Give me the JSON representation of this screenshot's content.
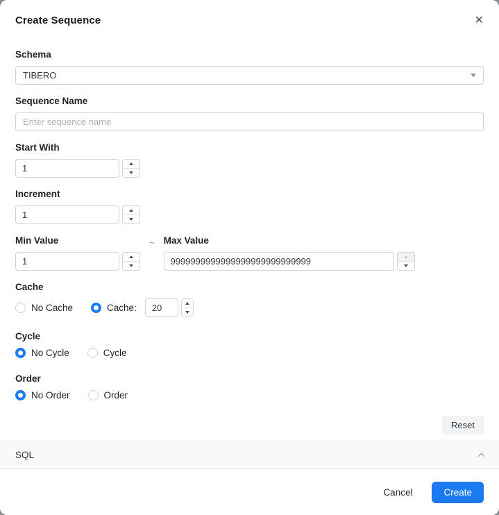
{
  "dialog": {
    "title": "Create Sequence"
  },
  "fields": {
    "schema": {
      "label": "Schema",
      "value": "TIBERO"
    },
    "sequence_name": {
      "label": "Sequence Name",
      "placeholder": "Enter sequence name"
    },
    "start_with": {
      "label": "Start With",
      "value": "1"
    },
    "increment": {
      "label": "Increment",
      "value": "1"
    },
    "min_value": {
      "label": "Min Value",
      "value": "1"
    },
    "range_separator": "~",
    "max_value": {
      "label": "Max Value",
      "value": "9999999999999999999999999999"
    },
    "cache": {
      "label": "Cache",
      "options": [
        {
          "label": "No Cache",
          "selected": false
        },
        {
          "label": "Cache:",
          "selected": true
        }
      ],
      "cache_size": "20"
    },
    "cycle": {
      "label": "Cycle",
      "options": [
        {
          "label": "No Cycle",
          "selected": true
        },
        {
          "label": "Cycle",
          "selected": false
        }
      ]
    },
    "order": {
      "label": "Order",
      "options": [
        {
          "label": "No Order",
          "selected": true
        },
        {
          "label": "Order",
          "selected": false
        }
      ]
    }
  },
  "sql_section": {
    "label": "SQL"
  },
  "buttons": {
    "reset": "Reset",
    "cancel": "Cancel",
    "create": "Create"
  },
  "colors": {
    "accent": "#1b7af2"
  }
}
